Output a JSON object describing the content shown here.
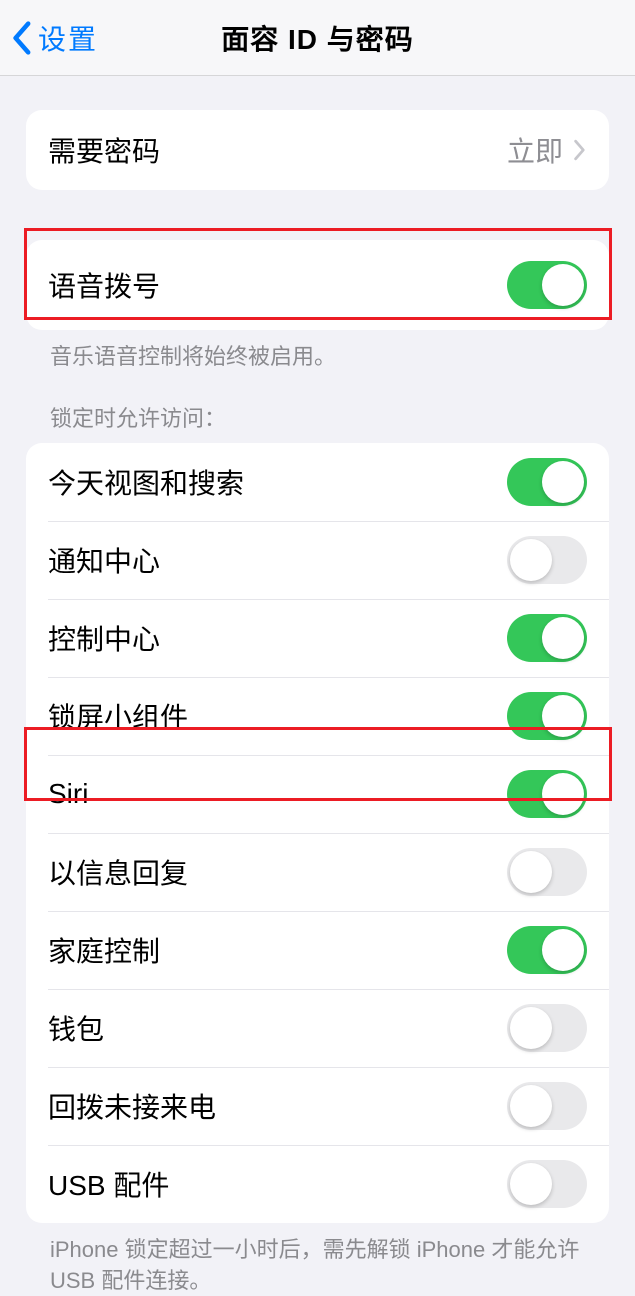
{
  "nav": {
    "back": "设置",
    "title": "面容 ID 与密码"
  },
  "require_passcode": {
    "label": "需要密码",
    "value": "立即"
  },
  "voice_dial": {
    "label": "语音拨号",
    "on": true,
    "footer": "音乐语音控制将始终被启用。"
  },
  "locked_access": {
    "header": "锁定时允许访问：",
    "items": [
      {
        "label": "今天视图和搜索",
        "on": true
      },
      {
        "label": "通知中心",
        "on": false
      },
      {
        "label": "控制中心",
        "on": true
      },
      {
        "label": "锁屏小组件",
        "on": true
      },
      {
        "label": "Siri",
        "on": true
      },
      {
        "label": "以信息回复",
        "on": false
      },
      {
        "label": "家庭控制",
        "on": true
      },
      {
        "label": "钱包",
        "on": false
      },
      {
        "label": "回拨未接来电",
        "on": false
      },
      {
        "label": "USB 配件",
        "on": false
      }
    ],
    "footer": "iPhone 锁定超过一小时后，需先解锁 iPhone 才能允许 USB 配件连接。"
  }
}
